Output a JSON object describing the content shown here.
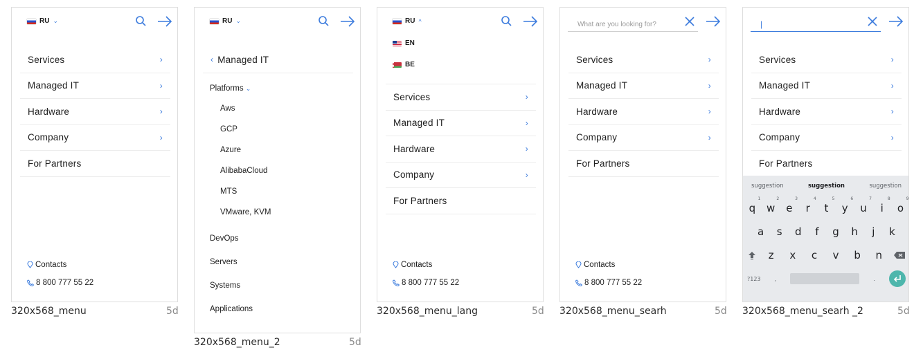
{
  "menu": {
    "items": [
      {
        "label": "Services",
        "arrow": "›"
      },
      {
        "label": "Managed IT",
        "arrow": "›"
      },
      {
        "label": "Hardware",
        "arrow": "›"
      },
      {
        "label": "Company",
        "arrow": "›"
      },
      {
        "label": "For Partners",
        "arrow": ""
      }
    ]
  },
  "lang": {
    "current": "RU",
    "options": [
      "EN",
      "BE"
    ],
    "chevron_down": "⌄",
    "chevron_up": "^"
  },
  "contacts": {
    "label": "Contacts",
    "phone": "8 800 777 55 22"
  },
  "submenu": {
    "back_label": "Managed IT",
    "group_label": "Platforms",
    "platforms": [
      "Aws",
      "GCP",
      "Azure",
      "AlibabaCloud",
      "MTS",
      "VMware, KVM"
    ],
    "others": [
      "DevOps",
      "Servers",
      "Systems",
      "Applications"
    ]
  },
  "search": {
    "placeholder": "What are you looking for?",
    "typed": "|"
  },
  "keyboard": {
    "suggestions": [
      "suggestion",
      "suggestion",
      "suggestion"
    ],
    "row1": [
      "q",
      "w",
      "e",
      "r",
      "t",
      "y",
      "u",
      "i",
      "o"
    ],
    "row1_hints": [
      "1",
      "2",
      "3",
      "4",
      "5",
      "6",
      "7",
      "8",
      "9"
    ],
    "row2": [
      "a",
      "s",
      "d",
      "f",
      "g",
      "h",
      "j",
      "k"
    ],
    "row3": [
      "z",
      "x",
      "c",
      "v",
      "b",
      "n"
    ],
    "mode_key": "?123",
    "comma_key": ",",
    "period_key": "."
  },
  "frames": [
    {
      "caption": "320x568_menu",
      "age": "5d"
    },
    {
      "caption": "320x568_menu_2",
      "age": "5d"
    },
    {
      "caption": "320x568_menu_lang",
      "age": "5d"
    },
    {
      "caption": "320x568_menu_searh",
      "age": "5d"
    },
    {
      "caption": "320x568_menu_searh _2",
      "age": "5d"
    }
  ],
  "colors": {
    "accent": "#3b7bdd",
    "border": "#dedede",
    "keyboard_bg": "#e8eaed",
    "enter_key": "#4db6ac"
  }
}
